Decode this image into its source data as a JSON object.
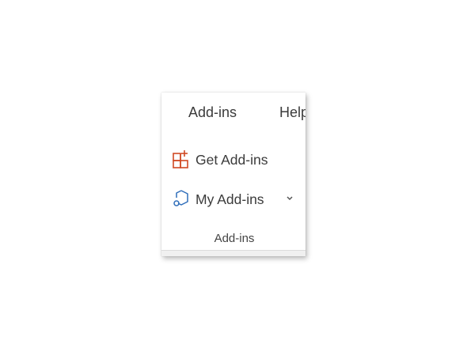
{
  "ribbon": {
    "tabs": [
      {
        "label": "Add-ins"
      },
      {
        "label": "Help"
      }
    ],
    "commands": {
      "get_addins": {
        "label": "Get Add-ins",
        "icon": "get-addins-icon",
        "color": "#D04A24"
      },
      "my_addins": {
        "label": "My Add-ins",
        "icon": "my-addins-icon",
        "color": "#2F6EBA",
        "dropdown_icon": "chevron-down-icon"
      }
    },
    "group": {
      "label": "Add-ins"
    }
  }
}
